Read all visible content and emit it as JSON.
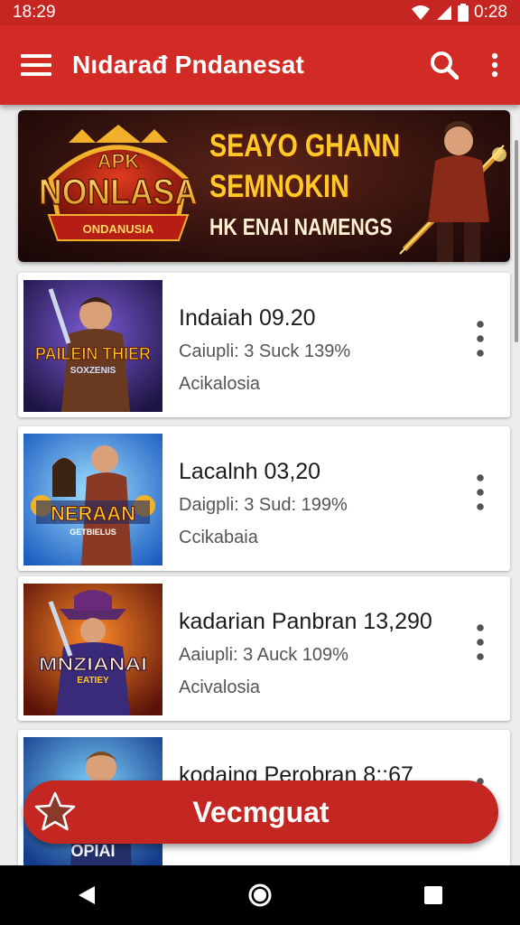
{
  "status_bar": {
    "time": "18:29",
    "battery_time": "0:28"
  },
  "app_bar": {
    "title": "Nıdarađ Pndanesat"
  },
  "banner": {
    "logo_top": "APK",
    "logo_main": "NONLASA",
    "logo_ribbon": "ONDANUSIA",
    "headline_1": "SEAYO GHANN",
    "headline_2": "SEMNOKIN",
    "subline": "ΗΚ ΕΝΑΙ ΝΑΜΕΝGS"
  },
  "cards": [
    {
      "title": "Indaiah 09.20",
      "meta": "Caiupli:  3 Suck 139%",
      "sub": "Acikalosia",
      "thumb_text": "PAILEIN THIER",
      "thumb_sub": "SOXZENIS"
    },
    {
      "title": "Lacalnh 03,20",
      "meta": "Daigpli:  3 Sud: 199%",
      "sub": "Ccikabaia",
      "thumb_text": "NERAAN",
      "thumb_sub": "GETBIELUS"
    },
    {
      "title": "kadarian Panbran 13,290",
      "meta": "Aaiupli:  3 Auck 109%",
      "sub": "Acivalosia",
      "thumb_text": "MNZIANAI",
      "thumb_sub": "EATIEY"
    },
    {
      "title": "kodaing Perobran 8::67",
      "meta": "",
      "sub": "",
      "thumb_text": "OPIAI",
      "thumb_sub": ""
    }
  ],
  "fab": {
    "label": "Vecmguat"
  },
  "colors": {
    "primary": "#d22a25",
    "status": "#c62622",
    "fab": "#c42621",
    "gold": "#ffc928"
  },
  "icons": {
    "menu": "hamburger-menu-icon",
    "search": "search-icon",
    "overflow": "more-vert-icon",
    "fab": "star-icon",
    "nav_back": "back-triangle-icon",
    "nav_home": "home-circle-icon",
    "nav_recents": "recents-square-icon"
  }
}
